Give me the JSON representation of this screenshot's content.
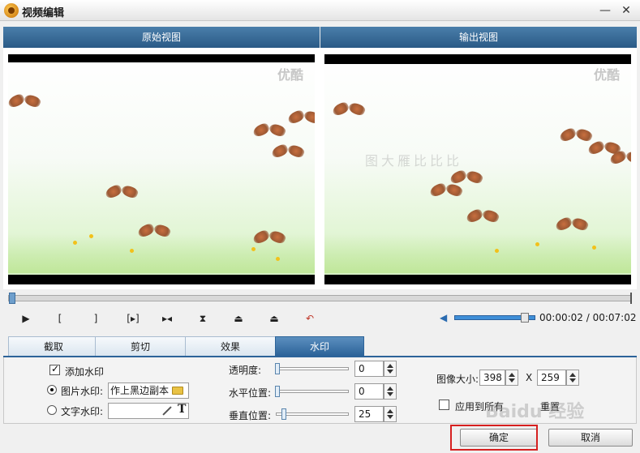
{
  "window": {
    "title": "视频编辑",
    "minimize_glyph": "—",
    "close_glyph": "✕"
  },
  "views": {
    "original_label": "原始视图",
    "output_label": "输出视图",
    "watermark_text": "优酷",
    "output_overlay_text": "图大雁比比比"
  },
  "playback": {
    "time_current": "00:00:02",
    "time_total": "00:07:02",
    "time_display": "00:00:02 / 00:07:02",
    "seek_fraction": 0.0,
    "volume_fraction": 0.9,
    "controls": [
      {
        "name": "play-icon",
        "glyph": "▶"
      },
      {
        "name": "mark-in-icon",
        "glyph": "["
      },
      {
        "name": "mark-out-icon",
        "glyph": "]"
      },
      {
        "name": "play-selection-icon",
        "glyph": "[▸]"
      },
      {
        "name": "step-frame-icon",
        "glyph": "▸◂"
      },
      {
        "name": "hourglass-icon",
        "glyph": "⧗"
      },
      {
        "name": "flip-up-icon",
        "glyph": "⏏"
      },
      {
        "name": "flip-right-icon",
        "glyph": "⏏"
      },
      {
        "name": "undo-icon",
        "glyph": "↶"
      }
    ]
  },
  "tabs": [
    {
      "label": "截取",
      "active": false
    },
    {
      "label": "剪切",
      "active": false
    },
    {
      "label": "效果",
      "active": false
    },
    {
      "label": "水印",
      "active": true
    }
  ],
  "watermark_panel": {
    "add_watermark_label": "添加水印",
    "add_watermark_checked": true,
    "image_watermark_label": "图片水印:",
    "image_watermark_selected": true,
    "image_watermark_value": "作上黑边副本",
    "text_watermark_label": "文字水印:",
    "text_watermark_value": "",
    "opacity_label": "透明度:",
    "opacity_value": "0",
    "horizontal_label": "水平位置:",
    "horizontal_value": "0",
    "vertical_label": "垂直位置:",
    "vertical_value": "25",
    "image_size_label": "图像大小:",
    "image_width": "398",
    "image_height": "259",
    "size_separator": "X",
    "apply_all_label": "应用到所有",
    "apply_all_checked": false,
    "reset_label": "重置"
  },
  "footer": {
    "ok_label": "确定",
    "cancel_label": "取消"
  },
  "brand_watermark": "Baidu 经验",
  "colors": {
    "header_blue": "#2a5a86",
    "active_tab": "#2c6399",
    "highlight_red": "#d62020"
  }
}
